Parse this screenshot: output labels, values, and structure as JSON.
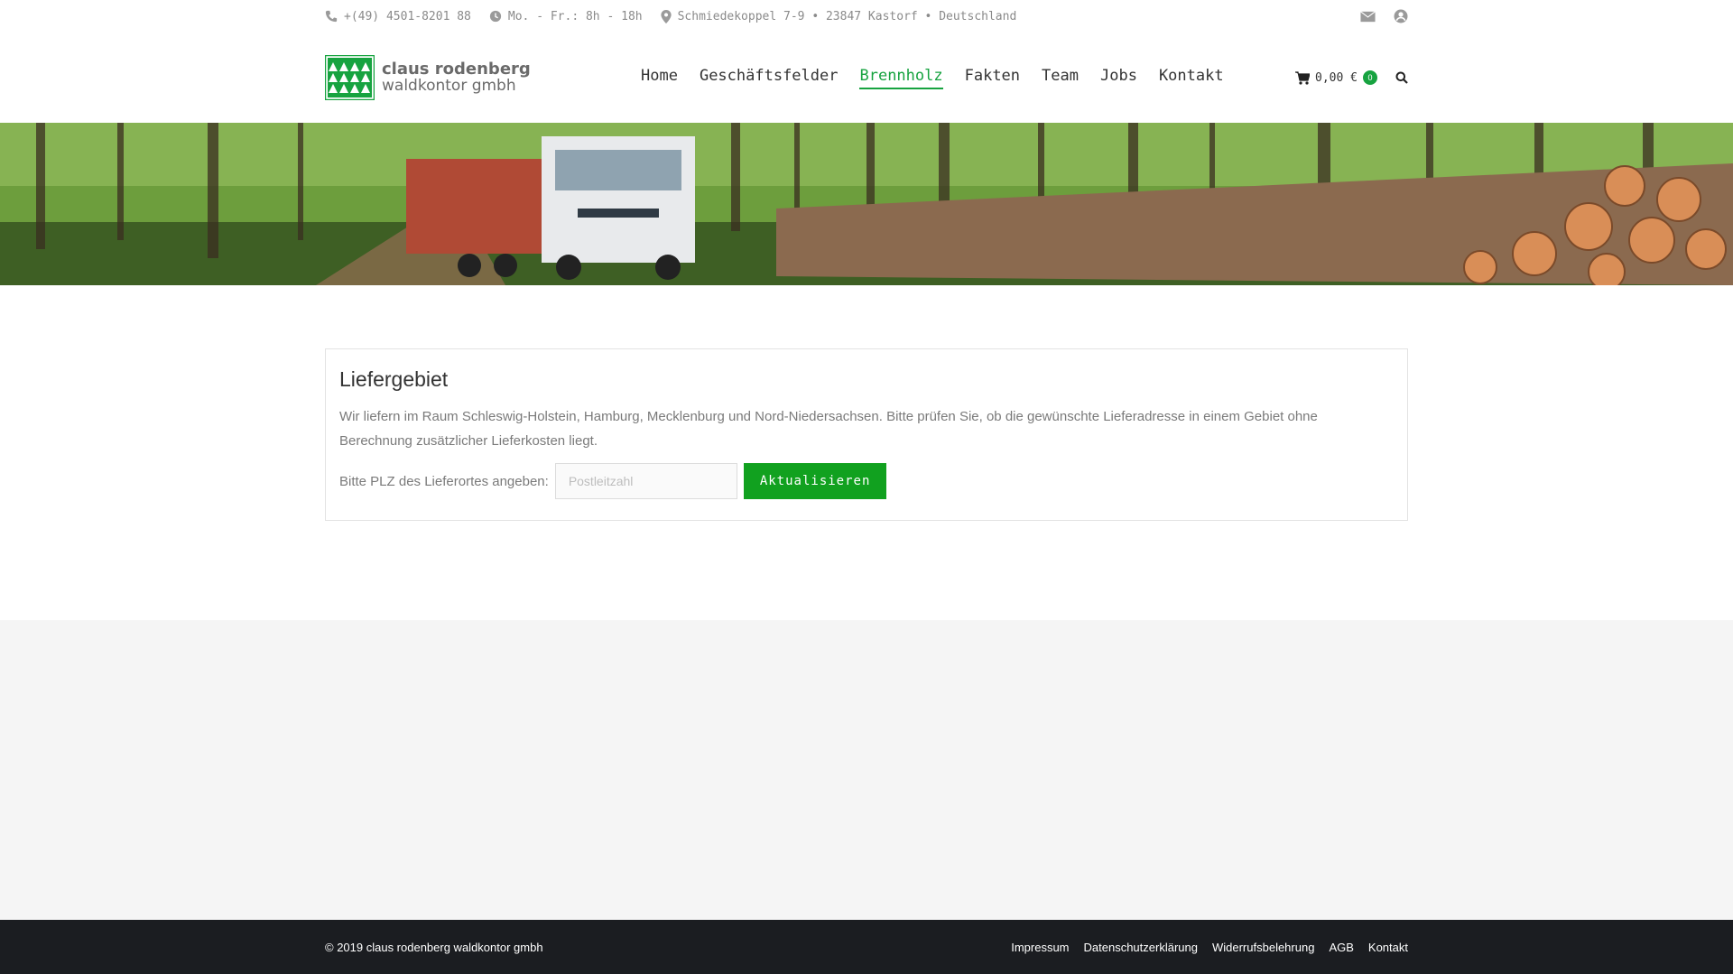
{
  "topbar": {
    "phone": "+(49) 4501-8201 88",
    "hours": "Mo. - Fr.: 8h - 18h",
    "address": "Schmiedekoppel 7-9 • 23847 Kastorf • Deutschland",
    "icons": [
      "phone-icon",
      "clock-icon",
      "location-icon",
      "mail-icon",
      "account-icon"
    ]
  },
  "header": {
    "logo_line1": "claus rodenberg",
    "logo_line2": "waldkontor gmbh",
    "nav": [
      {
        "label": "Home"
      },
      {
        "label": "Geschäftsfelder"
      },
      {
        "label": "Brennholz",
        "active": true
      },
      {
        "label": "Fakten"
      },
      {
        "label": "Team"
      },
      {
        "label": "Jobs"
      },
      {
        "label": "Kontakt"
      }
    ],
    "cart_total": "0,00 €",
    "cart_count": "0"
  },
  "main": {
    "title": "Liefergebiet",
    "description": "Wir liefern im Raum Schleswig-Holstein, Hamburg, Mecklenburg und Nord-Niedersachsen. Bitte prüfen Sie, ob die gewünschte Lieferadresse in einem Gebiet ohne Berechnung zusätzlicher Lieferkosten liegt.",
    "plz_label": "Bitte PLZ des Lieferortes angeben:",
    "plz_placeholder": "Postleitzahl",
    "plz_value": "",
    "button_label": "Aktualisieren"
  },
  "footer": {
    "copyright": "© 2019 claus rodenberg waldkontor gmbh",
    "links": [
      "Impressum",
      "Datenschutzerklärung",
      "Widerrufsbelehrung",
      "AGB",
      "Kontakt"
    ]
  },
  "colors": {
    "accent": "#17a340",
    "button": "#11a11f",
    "footer_bg": "#1b1d21",
    "gray_bg": "#f5f5f5"
  }
}
